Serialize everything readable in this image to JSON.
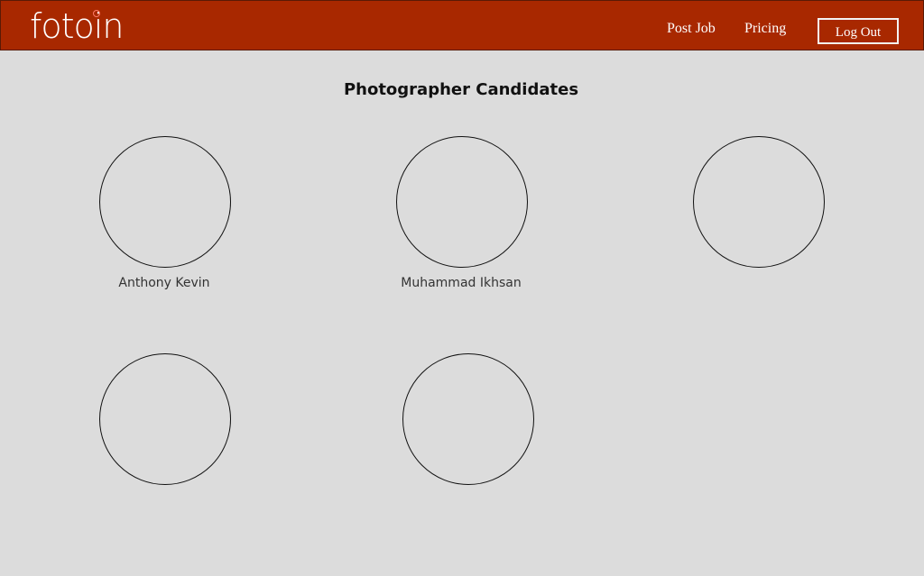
{
  "header": {
    "logo_text": "fotoin",
    "nav": {
      "post_job": "Post Job",
      "pricing": "Pricing",
      "log_out": "Log Out"
    }
  },
  "main": {
    "title": "Photographer Candidates",
    "candidates": [
      {
        "name": "Anthony Kevin"
      },
      {
        "name": "Muhammad Ikhsan"
      },
      {
        "name": ""
      },
      {
        "name": ""
      },
      {
        "name": ""
      }
    ]
  },
  "colors": {
    "header_bg": "#a82800",
    "page_bg": "#dcdcdc",
    "logo_accent": "#ff7a6a"
  },
  "icons": {
    "avatar": "avatar-placeholder-circle"
  }
}
